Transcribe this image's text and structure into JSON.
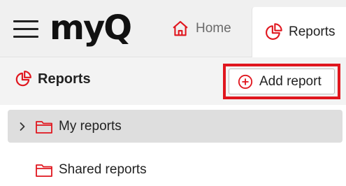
{
  "brand": {
    "logo_text": "myQ",
    "accent_color": "#e0161e"
  },
  "topbar": {
    "menu_icon": "hamburger-menu-icon",
    "tabs": [
      {
        "label": "Home",
        "icon": "home-icon",
        "active": false
      },
      {
        "label": "Reports",
        "icon": "pie-chart-icon",
        "active": true
      }
    ]
  },
  "panel": {
    "title": "Reports",
    "title_icon": "pie-chart-icon",
    "add_button_label": "Add report",
    "add_button_icon": "plus-circle-icon"
  },
  "tree": {
    "items": [
      {
        "label": "My reports",
        "icon": "folder-icon",
        "expandable": true,
        "selected": true
      },
      {
        "label": "Shared reports",
        "icon": "folder-icon",
        "expandable": false,
        "selected": false
      }
    ]
  }
}
